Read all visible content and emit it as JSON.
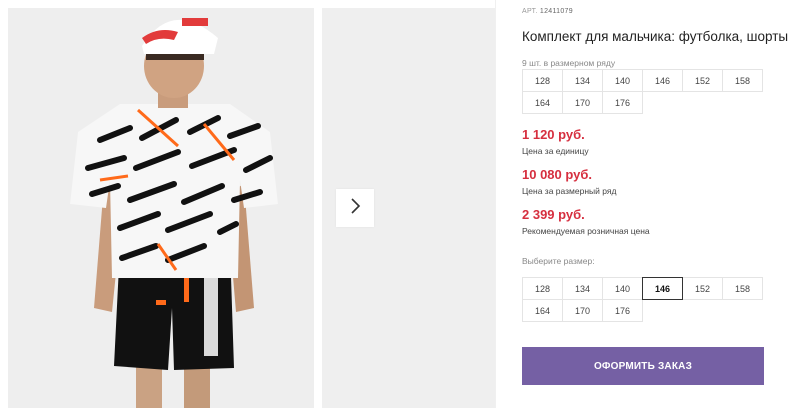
{
  "product": {
    "art_label": "АРТ.",
    "art_code": "12411079",
    "title": "Комплект для мальчика: футболка, шорты",
    "pack_note": "9 шт. в размерном ряду",
    "pack_sizes": [
      "128",
      "134",
      "140",
      "146",
      "152",
      "158",
      "164",
      "170",
      "176"
    ]
  },
  "prices": {
    "unit_price": "1 120 руб.",
    "unit_label": "Цена за единицу",
    "pack_price": "10 080 руб.",
    "pack_label": "Цена за размерный ряд",
    "retail_price": "2 399 руб.",
    "retail_label": "Рекомендуемая розничная цена"
  },
  "size_selector": {
    "label": "Выберите размер:",
    "options": [
      "128",
      "134",
      "140",
      "146",
      "152",
      "158",
      "164",
      "170",
      "176"
    ],
    "selected": "146"
  },
  "order_button": {
    "label": "ОФОРМИТЬ ЗАКАЗ"
  },
  "colors": {
    "price_red": "#d62f3f",
    "button_purple": "#7560a4",
    "photo_bg": "#eeeeee"
  },
  "icons": {
    "gallery_next": "chevron-right-icon"
  }
}
